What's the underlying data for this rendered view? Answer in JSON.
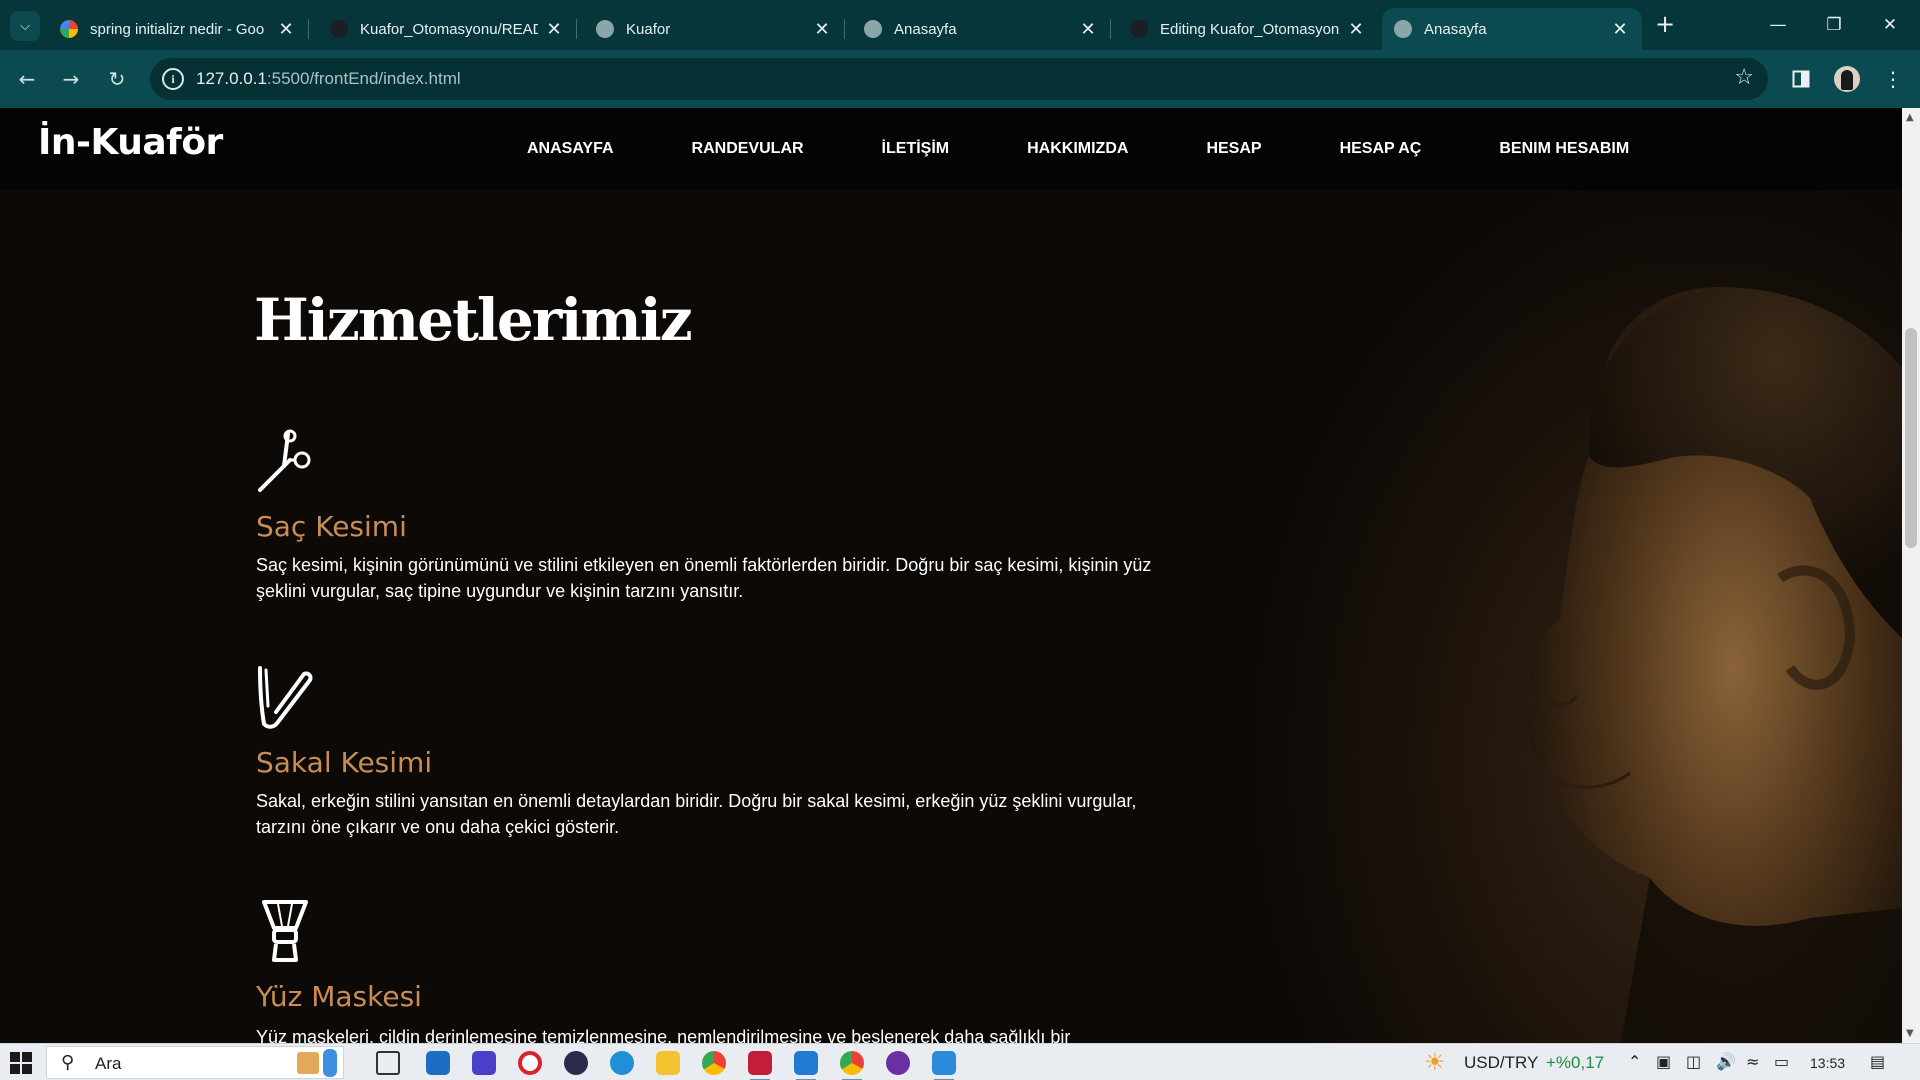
{
  "browser": {
    "tabs": [
      {
        "title": "spring initializr nedir - Goo",
        "favicon_color": "#ffffff",
        "active": false
      },
      {
        "title": "Kuafor_Otomasyonu/READ",
        "favicon_color": "#1b1f23",
        "active": false
      },
      {
        "title": "Kuafor",
        "favicon_color": "#8aa6a9",
        "active": false
      },
      {
        "title": "Anasayfa",
        "favicon_color": "#8aa6a9",
        "active": false
      },
      {
        "title": "Editing Kuafor_Otomasyon",
        "favicon_color": "#1b1f23",
        "active": false
      },
      {
        "title": "Anasayfa",
        "favicon_color": "#8aa6a9",
        "active": true
      }
    ],
    "url_host": "127.0.0.1",
    "url_rest": ":5500/frontEnd/index.html",
    "icons": {
      "close": "close-icon",
      "new_tab": "plus-icon",
      "back": "back-arrow-icon",
      "forward": "forward-arrow-icon",
      "reload": "reload-icon",
      "bookmark": "star-icon"
    }
  },
  "site": {
    "logo": "İn-Kuaför",
    "nav": [
      "ANASAYFA",
      "RANDEVULAR",
      "İLETİŞİM",
      "HAKKIMIZDA",
      "HESAP",
      "HESAP AÇ",
      "BENIM HESABIM"
    ],
    "section_title": "Hizmetlerimiz",
    "services": [
      {
        "icon": "scissors-icon",
        "name": "Saç Kesimi",
        "desc": "Saç kesimi, kişinin görünümünü ve stilini etkileyen en önemli faktörlerden biridir. Doğru bir saç kesimi, kişinin yüz şeklini vurgular, saç tipine uygundur ve kişinin tarzını yansıtır."
      },
      {
        "icon": "razor-icon",
        "name": "Sakal Kesimi",
        "desc": "Sakal, erkeğin stilini yansıtan en önemli detaylardan biridir. Doğru bir sakal kesimi, erkeğin yüz şeklini vurgular, tarzını öne çıkarır ve onu daha çekici gösterir."
      },
      {
        "icon": "shaving-brush-icon",
        "name": "Yüz Maskesi",
        "desc": "Yüz maskeleri, cildin derinlemesine temizlenmesine, nemlendirilmesine ve beslenerek daha sağlıklı bir"
      }
    ],
    "accent_color": "#c78d55"
  },
  "taskbar": {
    "search_placeholder": "Ara",
    "currency": "USD/TRY",
    "currency_change": "+%0,17",
    "clock": "13:53"
  }
}
